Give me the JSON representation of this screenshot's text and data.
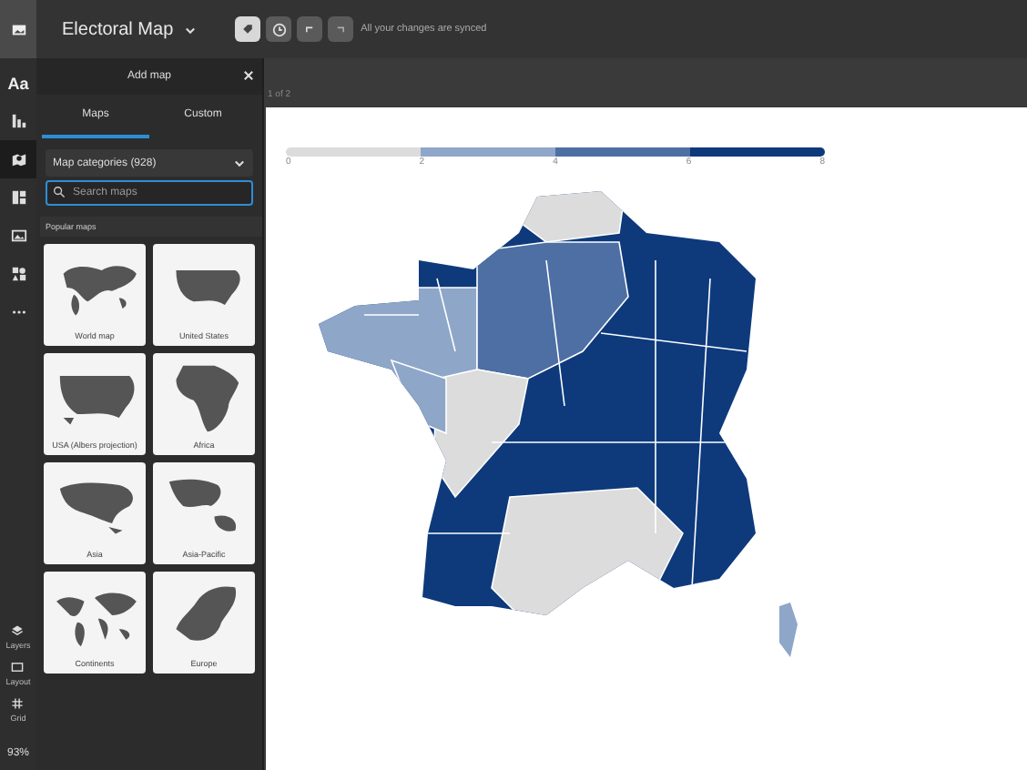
{
  "top_bar": {
    "title": "Electoral Map",
    "status": "All your changes are synced"
  },
  "rail": {
    "text_tool": "Aa",
    "tools": [
      {
        "selected": false
      },
      {
        "selected": true
      },
      {
        "selected": false
      },
      {
        "selected": false
      },
      {
        "selected": false
      },
      {
        "selected": false
      }
    ],
    "bottom": [
      {
        "label": "Layers"
      },
      {
        "label": "Layout"
      },
      {
        "label": "Grid"
      }
    ],
    "zoom": "93%"
  },
  "panel": {
    "title": "Add map",
    "tabs": [
      {
        "label": "Maps",
        "selected": true
      },
      {
        "label": "Custom",
        "selected": false
      }
    ],
    "dropdown": "Map categories (928)",
    "search": {
      "placeholder": "Search maps"
    },
    "section": "Popular maps",
    "maps": [
      {
        "label": "World map"
      },
      {
        "label": "United States"
      },
      {
        "label": "USA (Albers projection)"
      },
      {
        "label": "Africa"
      },
      {
        "label": "Asia"
      },
      {
        "label": "Asia-Pacific"
      },
      {
        "label": "Continents"
      },
      {
        "label": "Europe"
      }
    ]
  },
  "canvas": {
    "page_counter": "1 of 2",
    "legend": {
      "ticks": [
        "0",
        "2",
        "4",
        "6",
        "8"
      ],
      "segments": [
        {
          "color": "#dcdcdc"
        },
        {
          "color": "#8ea6c8"
        },
        {
          "color": "#4d6fa3"
        },
        {
          "color": "#0e3a7c"
        }
      ]
    }
  }
}
